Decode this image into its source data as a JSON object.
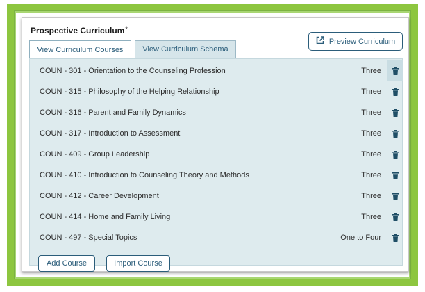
{
  "section": {
    "title": "Prospective Curriculum",
    "required_mark": "*"
  },
  "tabs": [
    {
      "label": "View Curriculum Courses",
      "active": true
    },
    {
      "label": "View Curriculum Schema",
      "active": false
    }
  ],
  "preview_button": {
    "label": "Preview Curriculum",
    "icon": "external-link-icon"
  },
  "courses": [
    {
      "name": "COUN - 301 - Orientation to the Counseling Profession",
      "credits": "Three"
    },
    {
      "name": "COUN - 315 - Philosophy of the Helping Relationship",
      "credits": "Three"
    },
    {
      "name": "COUN - 316 - Parent and Family Dynamics",
      "credits": "Three"
    },
    {
      "name": "COUN - 317 - Introduction to Assessment",
      "credits": "Three"
    },
    {
      "name": "COUN - 409 - Group Leadership",
      "credits": "Three"
    },
    {
      "name": "COUN - 410 - Introduction to Counseling Theory and Methods",
      "credits": "Three"
    },
    {
      "name": "COUN - 412 - Career Development",
      "credits": "Three"
    },
    {
      "name": "COUN - 414 - Home and Family Living",
      "credits": "Three"
    },
    {
      "name": "COUN - 497 - Special Topics",
      "credits": "One to Four"
    }
  ],
  "actions": {
    "add_course": "Add Course",
    "import_course": "Import Course"
  },
  "colors": {
    "highlight_border": "#8dc63f",
    "accent": "#2b5d7a",
    "panel_bg": "#deebee",
    "trash_icon": "#1f4e66"
  }
}
